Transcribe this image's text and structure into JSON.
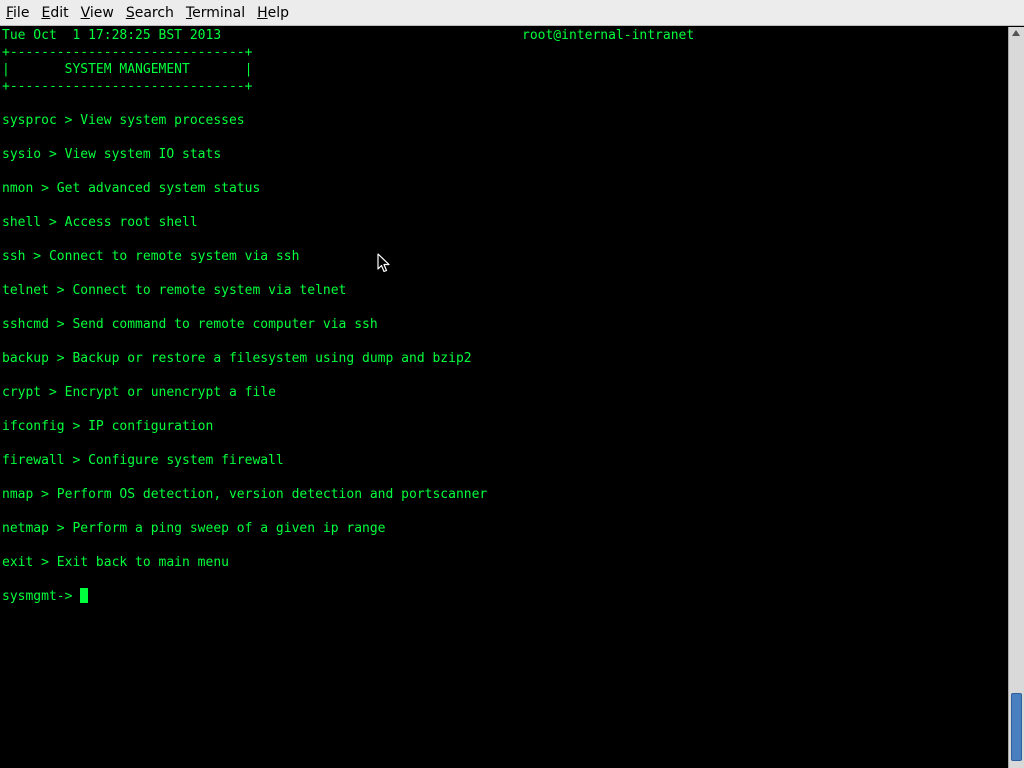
{
  "menubar": {
    "items": [
      "File",
      "Edit",
      "View",
      "Search",
      "Terminal",
      "Help"
    ]
  },
  "terminal": {
    "header_date": "Tue Oct  1 17:28:25 BST 2013",
    "header_host": "root@internal-intranet",
    "box_top": "+------------------------------+",
    "box_title": "|       SYSTEM MANGEMENT       |",
    "box_bottom": "+------------------------------+",
    "menu_options": [
      "sysproc > View system processes",
      "sysio > View system IO stats",
      "nmon > Get advanced system status",
      "shell > Access root shell",
      "ssh > Connect to remote system via ssh",
      "telnet > Connect to remote system via telnet",
      "sshcmd > Send command to remote computer via ssh",
      "backup > Backup or restore a filesystem using dump and bzip2",
      "crypt > Encrypt or unencrypt a file",
      "ifconfig > IP configuration",
      "firewall > Configure system firewall",
      "nmap > Perform OS detection, version detection and portscanner",
      "netmap > Perform a ping sweep of a given ip range",
      "exit > Exit back to main menu"
    ],
    "prompt": "sysmgmt-> "
  },
  "colors": {
    "terminal_text": "#00ff3c",
    "terminal_background": "#000000",
    "menubar_background": "#ececec",
    "scroll_thumb": "#4a7fbf"
  },
  "icons": {
    "scroll_up": "arrow-up-icon",
    "pointer": "mouse-pointer-icon"
  }
}
